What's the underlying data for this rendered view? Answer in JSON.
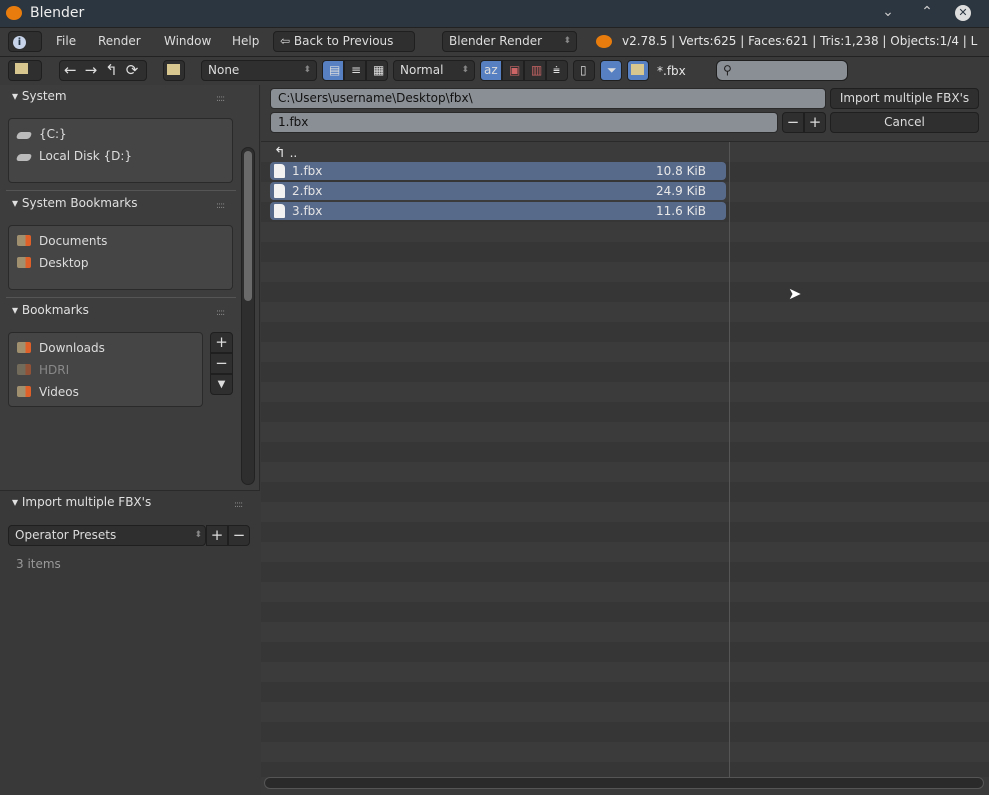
{
  "window": {
    "title": "Blender",
    "minimize": "⌄",
    "maximize": "⌃",
    "close": "✕"
  },
  "menubar": {
    "info_icon": "i",
    "items": [
      "File",
      "Render",
      "Window",
      "Help"
    ],
    "back_button": "Back to Previous",
    "render_engine": "Blender Render",
    "stats": "v2.78.5 | Verts:625 | Faces:621  | Tris:1,238 | Objects:1/4 | L"
  },
  "toolbar": {
    "recent": "None",
    "display_size": "Normal",
    "filter_text": "*.fbx",
    "search_placeholder": ""
  },
  "sidebar": {
    "system": {
      "title": "System",
      "items": [
        "{C:}",
        "Local Disk {D:}"
      ]
    },
    "system_bookmarks": {
      "title": "System Bookmarks",
      "items": [
        "Documents",
        "Desktop"
      ]
    },
    "bookmarks": {
      "title": "Bookmarks",
      "items": [
        "Downloads",
        "HDRI",
        "Videos"
      ]
    },
    "operator": {
      "title": "Import multiple FBX's",
      "presets": "Operator Presets",
      "count": "3 items"
    }
  },
  "main": {
    "path": "C:\\Users\\username\\Desktop\\fbx\\",
    "filename": "1.fbx",
    "import_button": "Import multiple FBX's",
    "cancel_button": "Cancel",
    "parent": "..",
    "files": [
      {
        "name": "1.fbx",
        "size": "10.8 KiB"
      },
      {
        "name": "2.fbx",
        "size": "24.9 KiB"
      },
      {
        "name": "3.fbx",
        "size": "11.6 KiB"
      }
    ]
  },
  "colors": {
    "accent": "#5680c2",
    "selected_row": "#586a8a",
    "titlebar": "#2c3640"
  }
}
